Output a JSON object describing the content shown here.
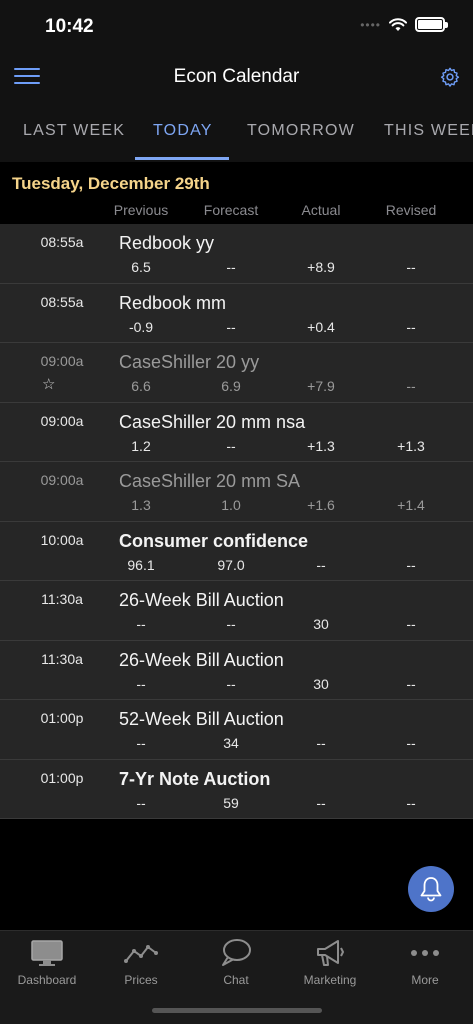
{
  "status_bar": {
    "time": "10:42"
  },
  "header": {
    "title": "Econ Calendar"
  },
  "tabs": [
    {
      "label": "LAST WEEK"
    },
    {
      "label": "TODAY",
      "active": true
    },
    {
      "label": "TOMORROW"
    },
    {
      "label": "THIS WEEK"
    }
  ],
  "date_label": "Tuesday, December 29th",
  "columns": {
    "previous": "Previous",
    "forecast": "Forecast",
    "actual": "Actual",
    "revised": "Revised"
  },
  "events": [
    {
      "time": "08:55a",
      "name": "Redbook yy",
      "previous": "6.5",
      "forecast": "--",
      "actual": "+8.9",
      "revised": "--"
    },
    {
      "time": "08:55a",
      "name": "Redbook mm",
      "previous": "-0.9",
      "forecast": "--",
      "actual": "+0.4",
      "revised": "--"
    },
    {
      "time": "09:00a",
      "name": "CaseShiller 20 yy",
      "previous": "6.6",
      "forecast": "6.9",
      "actual": "+7.9",
      "revised": "--",
      "star": "☆"
    },
    {
      "time": "09:00a",
      "name": "CaseShiller 20 mm nsa",
      "previous": "1.2",
      "forecast": "--",
      "actual": "+1.3",
      "revised": "+1.3"
    },
    {
      "time": "09:00a",
      "name": "CaseShiller 20 mm SA",
      "previous": "1.3",
      "forecast": "1.0",
      "actual": "+1.6",
      "revised": "+1.4"
    },
    {
      "time": "10:00a",
      "name": "Consumer confidence",
      "previous": "96.1",
      "forecast": "97.0",
      "actual": "--",
      "revised": "--"
    },
    {
      "time": "11:30a",
      "name": "26-Week Bill Auction",
      "previous": "--",
      "forecast": "--",
      "actual": "30",
      "revised": "--"
    },
    {
      "time": "11:30a",
      "name": "26-Week Bill Auction",
      "previous": "--",
      "forecast": "--",
      "actual": "30",
      "revised": "--"
    },
    {
      "time": "01:00p",
      "name": "52-Week Bill Auction",
      "previous": "--",
      "forecast": "34",
      "actual": "--",
      "revised": "--"
    },
    {
      "time": "01:00p",
      "name": "7-Yr Note Auction",
      "previous": "--",
      "forecast": "59",
      "actual": "--",
      "revised": "--"
    }
  ],
  "bottom_nav": [
    {
      "label": "Dashboard",
      "icon": "monitor-icon"
    },
    {
      "label": "Prices",
      "icon": "line-chart-icon"
    },
    {
      "label": "Chat",
      "icon": "chat-bubble-icon"
    },
    {
      "label": "Marketing",
      "icon": "megaphone-icon"
    },
    {
      "label": "More",
      "icon": "more-dots-icon"
    }
  ],
  "colors": {
    "accent": "#7ea6f3",
    "date": "#f5d48a",
    "fab": "#4e74c9",
    "row_bg": "#262626"
  }
}
